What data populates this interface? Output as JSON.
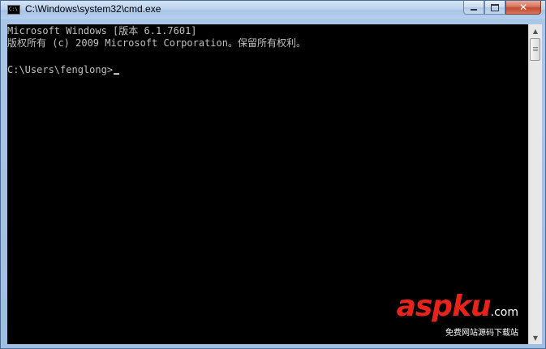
{
  "window": {
    "title": "C:\\Windows\\system32\\cmd.exe",
    "icon": "cmd-icon"
  },
  "console": {
    "lines": [
      "Microsoft Windows [版本 6.1.7601]",
      "版权所有 (c) 2009 Microsoft Corporation。保留所有权利。",
      "",
      "C:\\Users\\fenglong>"
    ],
    "text_color": "#c0c0c0",
    "background": "#000000"
  },
  "caption_buttons": {
    "minimize": "minimize-icon",
    "maximize": "maximize-icon",
    "close": "✕"
  },
  "watermark": {
    "brand_a": "asp",
    "brand_b": "ku",
    "brand_c": ".com",
    "tagline": "免费网站源码下载站"
  }
}
